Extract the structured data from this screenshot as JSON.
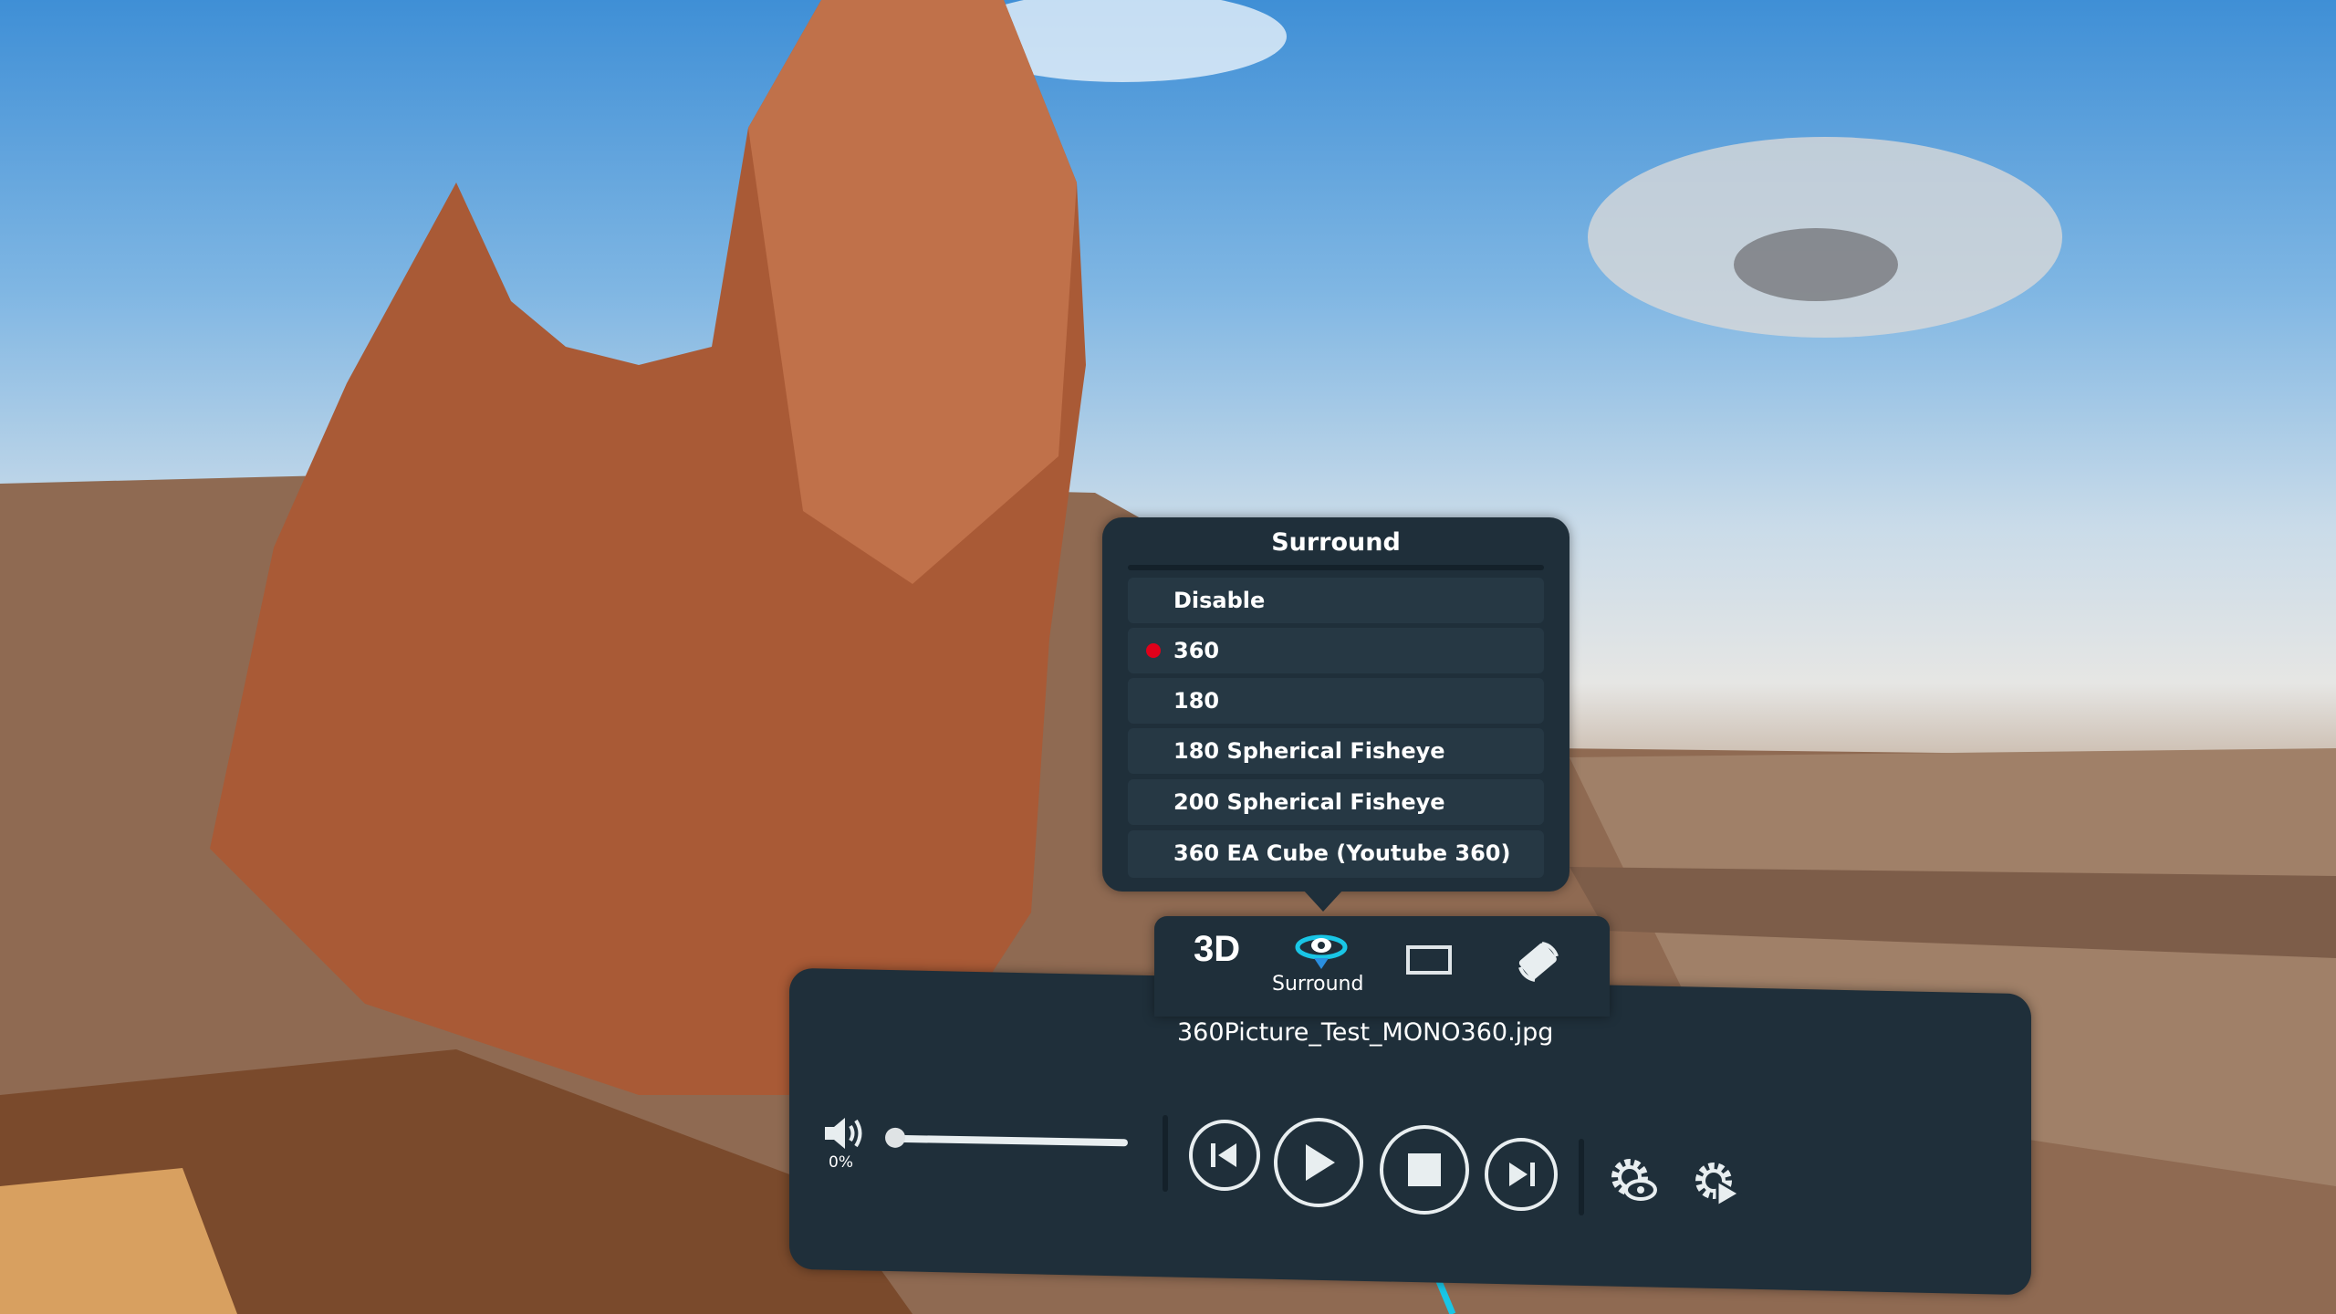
{
  "surround_menu": {
    "title": "Surround",
    "items": [
      {
        "label": "Disable",
        "selected": false
      },
      {
        "label": "360",
        "selected": true
      },
      {
        "label": "180",
        "selected": false
      },
      {
        "label": "180 Spherical Fisheye",
        "selected": false
      },
      {
        "label": "200 Spherical Fisheye",
        "selected": false
      },
      {
        "label": "360 EA Cube (Youtube 360)",
        "selected": false
      }
    ]
  },
  "toolbar": {
    "three_d_label": "3D",
    "surround_label": "Surround"
  },
  "player": {
    "filename": "360Picture_Test_MONO360.jpg",
    "volume_text": "0%",
    "volume_fraction": 0.0
  },
  "colors": {
    "panel": "#1f2f3a",
    "selected_dot": "#e0001a",
    "accent": "#19c6e6"
  }
}
